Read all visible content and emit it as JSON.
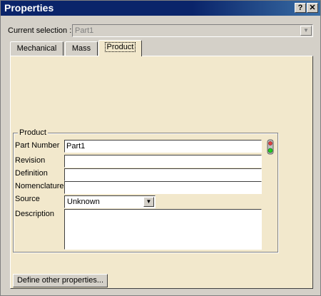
{
  "window": {
    "title": "Properties",
    "help_label": "?",
    "close_label": "✕"
  },
  "current_selection": {
    "label": "Current selection :",
    "value": "Part1"
  },
  "tabs": [
    {
      "label": "Mechanical",
      "active": false
    },
    {
      "label": "Mass",
      "active": false
    },
    {
      "label": "Product",
      "active": true
    }
  ],
  "product": {
    "group_title": "Product",
    "fields": [
      {
        "label": "Part Number",
        "value": "Part1"
      },
      {
        "label": "Revision",
        "value": ""
      },
      {
        "label": "Definition",
        "value": ""
      },
      {
        "label": "Nomenclature",
        "value": ""
      }
    ],
    "source": {
      "label": "Source",
      "value": "Unknown"
    },
    "description": {
      "label": "Description",
      "value": ""
    },
    "status_icon": "traffic-light-icon"
  },
  "actions": {
    "define_other_label": "Define other properties..."
  },
  "colors": {
    "title_bar": "#0a246a",
    "panel": "#f2e8cc",
    "chrome": "#d4d0c8"
  }
}
